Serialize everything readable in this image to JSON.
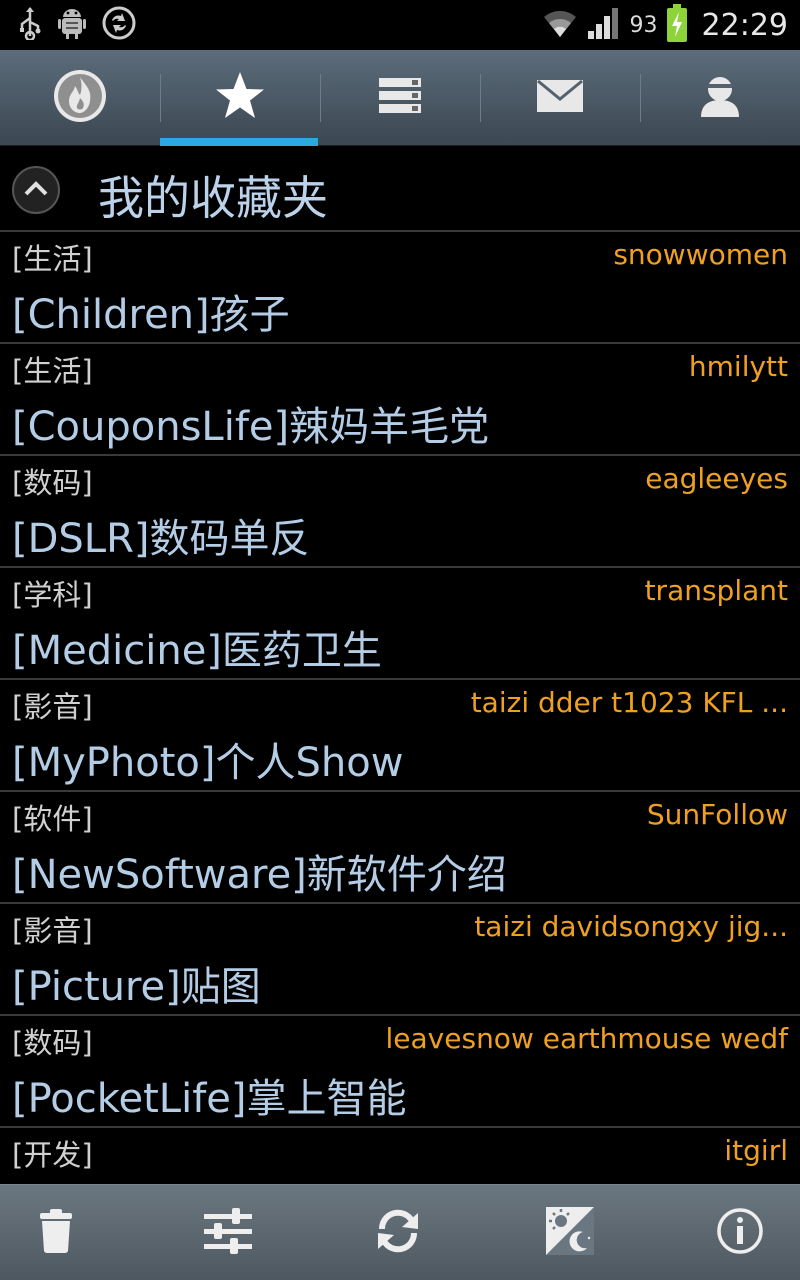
{
  "status_bar": {
    "icons_left": [
      "usb-icon",
      "android-debug-icon",
      "sync-icon"
    ],
    "icons_right": [
      "wifi-icon",
      "signal-icon"
    ],
    "battery_percent": "93",
    "time": "22:29"
  },
  "tabs": [
    {
      "name": "hot",
      "icon": "flame-icon",
      "active": false
    },
    {
      "name": "favorites",
      "icon": "star-icon",
      "active": true
    },
    {
      "name": "boards",
      "icon": "list-icon",
      "active": false
    },
    {
      "name": "mail",
      "icon": "mail-icon",
      "active": false
    },
    {
      "name": "profile",
      "icon": "user-icon",
      "active": false
    }
  ],
  "section": {
    "title": "我的收藏夹",
    "collapse_icon": "chevron-up-icon"
  },
  "boards": [
    {
      "category": "[生活]",
      "moderators": "snowwomen",
      "name": "[Children]孩子"
    },
    {
      "category": "[生活]",
      "moderators": "hmilytt",
      "name": "[CouponsLife]辣妈羊毛党"
    },
    {
      "category": "[数码]",
      "moderators": "eagleeyes",
      "name": "[DSLR]数码单反"
    },
    {
      "category": "[学科]",
      "moderators": "transplant",
      "name": "[Medicine]医药卫生"
    },
    {
      "category": "[影音]",
      "moderators": "taizi dder t1023 KFL ...",
      "name": "[MyPhoto]个人Show"
    },
    {
      "category": "[软件]",
      "moderators": "SunFollow",
      "name": "[NewSoftware]新软件介绍"
    },
    {
      "category": "[影音]",
      "moderators": "taizi davidsongxy jig...",
      "name": "[Picture]贴图"
    },
    {
      "category": "[数码]",
      "moderators": "leavesnow earthmouse wedf",
      "name": "[PocketLife]掌上智能"
    },
    {
      "category": "[开发]",
      "moderators": "itgirl",
      "name": ""
    }
  ],
  "bottom_bar": [
    {
      "name": "delete",
      "icon": "trash-icon"
    },
    {
      "name": "settings",
      "icon": "sliders-icon"
    },
    {
      "name": "refresh",
      "icon": "refresh-icon"
    },
    {
      "name": "day-night",
      "icon": "day-night-icon"
    },
    {
      "name": "about",
      "icon": "info-icon"
    }
  ],
  "colors": {
    "moderator": "#f0a020",
    "board_name": "#b4cde6",
    "tab_active_underline": "#2ea7e0"
  }
}
